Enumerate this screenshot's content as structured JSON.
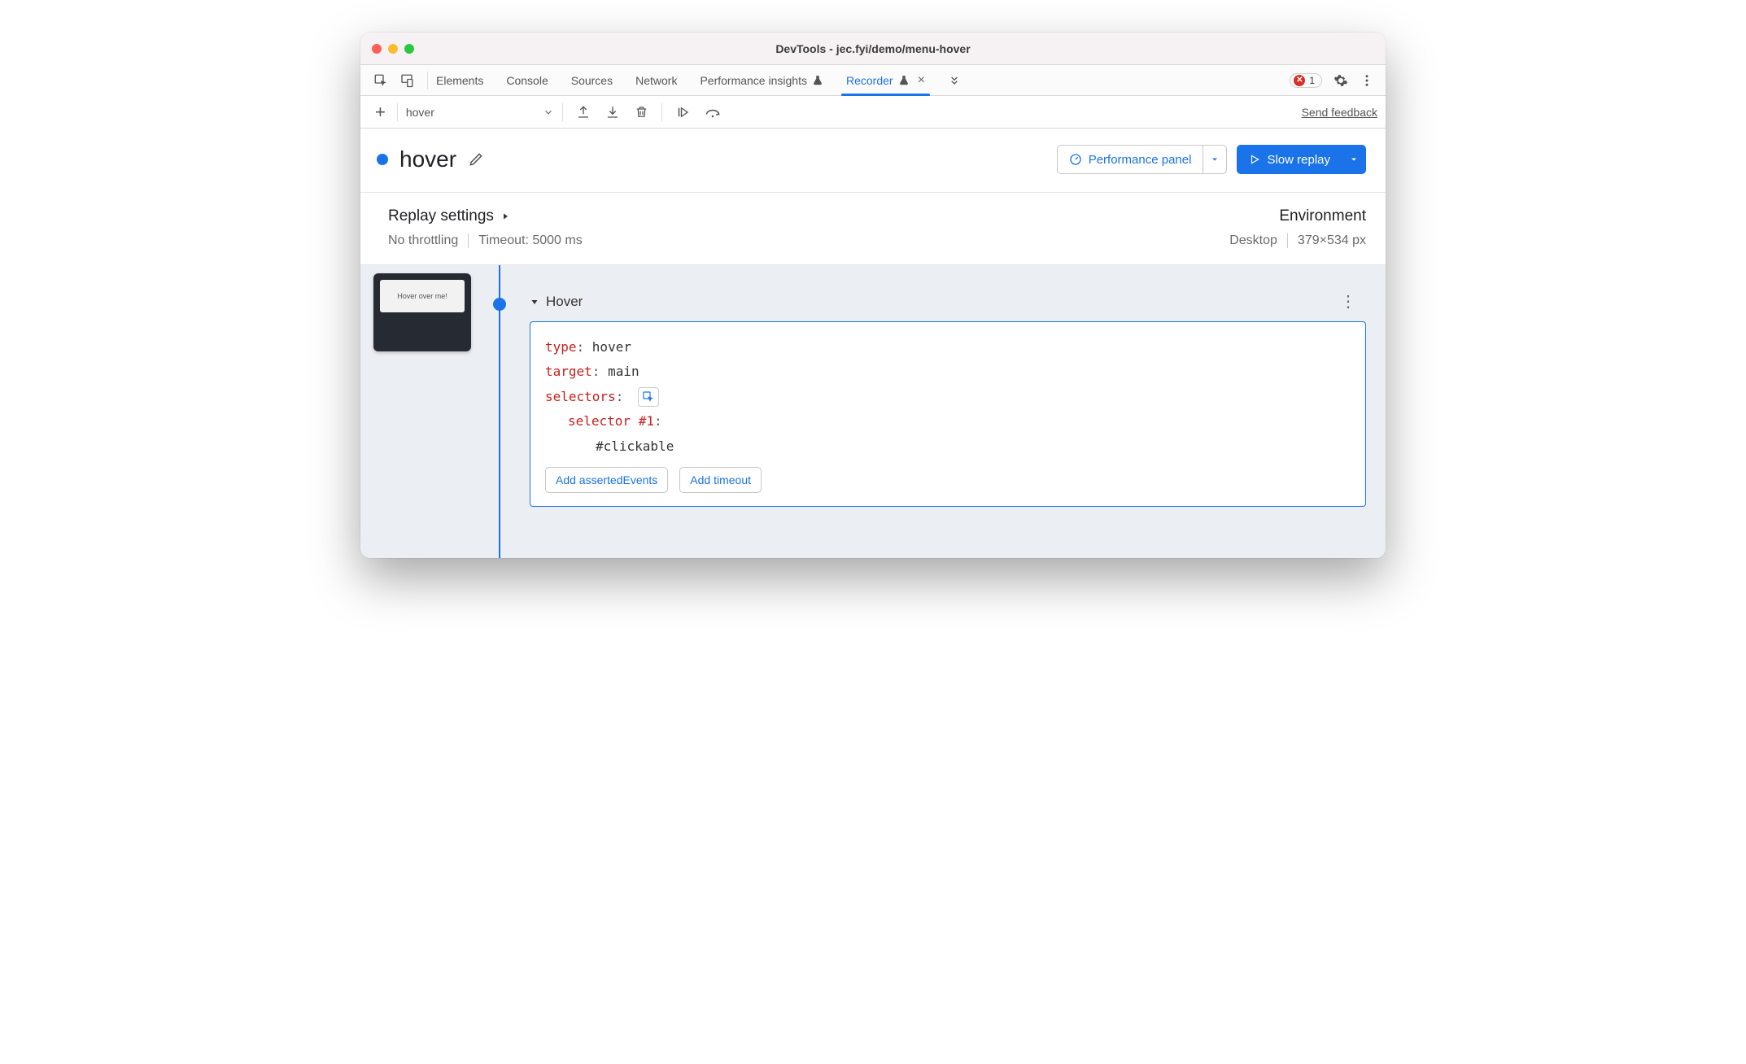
{
  "window": {
    "title": "DevTools - jec.fyi/demo/menu-hover"
  },
  "tabs": {
    "items": [
      "Elements",
      "Console",
      "Sources",
      "Network",
      "Performance insights",
      "Recorder"
    ],
    "active_index": 5
  },
  "errors": {
    "count": "1"
  },
  "toolbar": {
    "recording_name": "hover",
    "feedback": "Send feedback"
  },
  "recording": {
    "title": "hover",
    "buttons": {
      "performance": "Performance panel",
      "replay": "Slow replay"
    }
  },
  "settings": {
    "replay_heading": "Replay settings",
    "throttling": "No throttling",
    "timeout": "Timeout: 5000 ms",
    "env_heading": "Environment",
    "device": "Desktop",
    "dimensions": "379×534 px"
  },
  "thumbnail": {
    "label": "Hover over me!"
  },
  "step": {
    "title": "Hover",
    "type_key": "type",
    "type_val": "hover",
    "target_key": "target",
    "target_val": "main",
    "selectors_key": "selectors",
    "selector_label": "selector #1",
    "selector_value": "#clickable",
    "add_asserted": "Add assertedEvents",
    "add_timeout": "Add timeout"
  }
}
